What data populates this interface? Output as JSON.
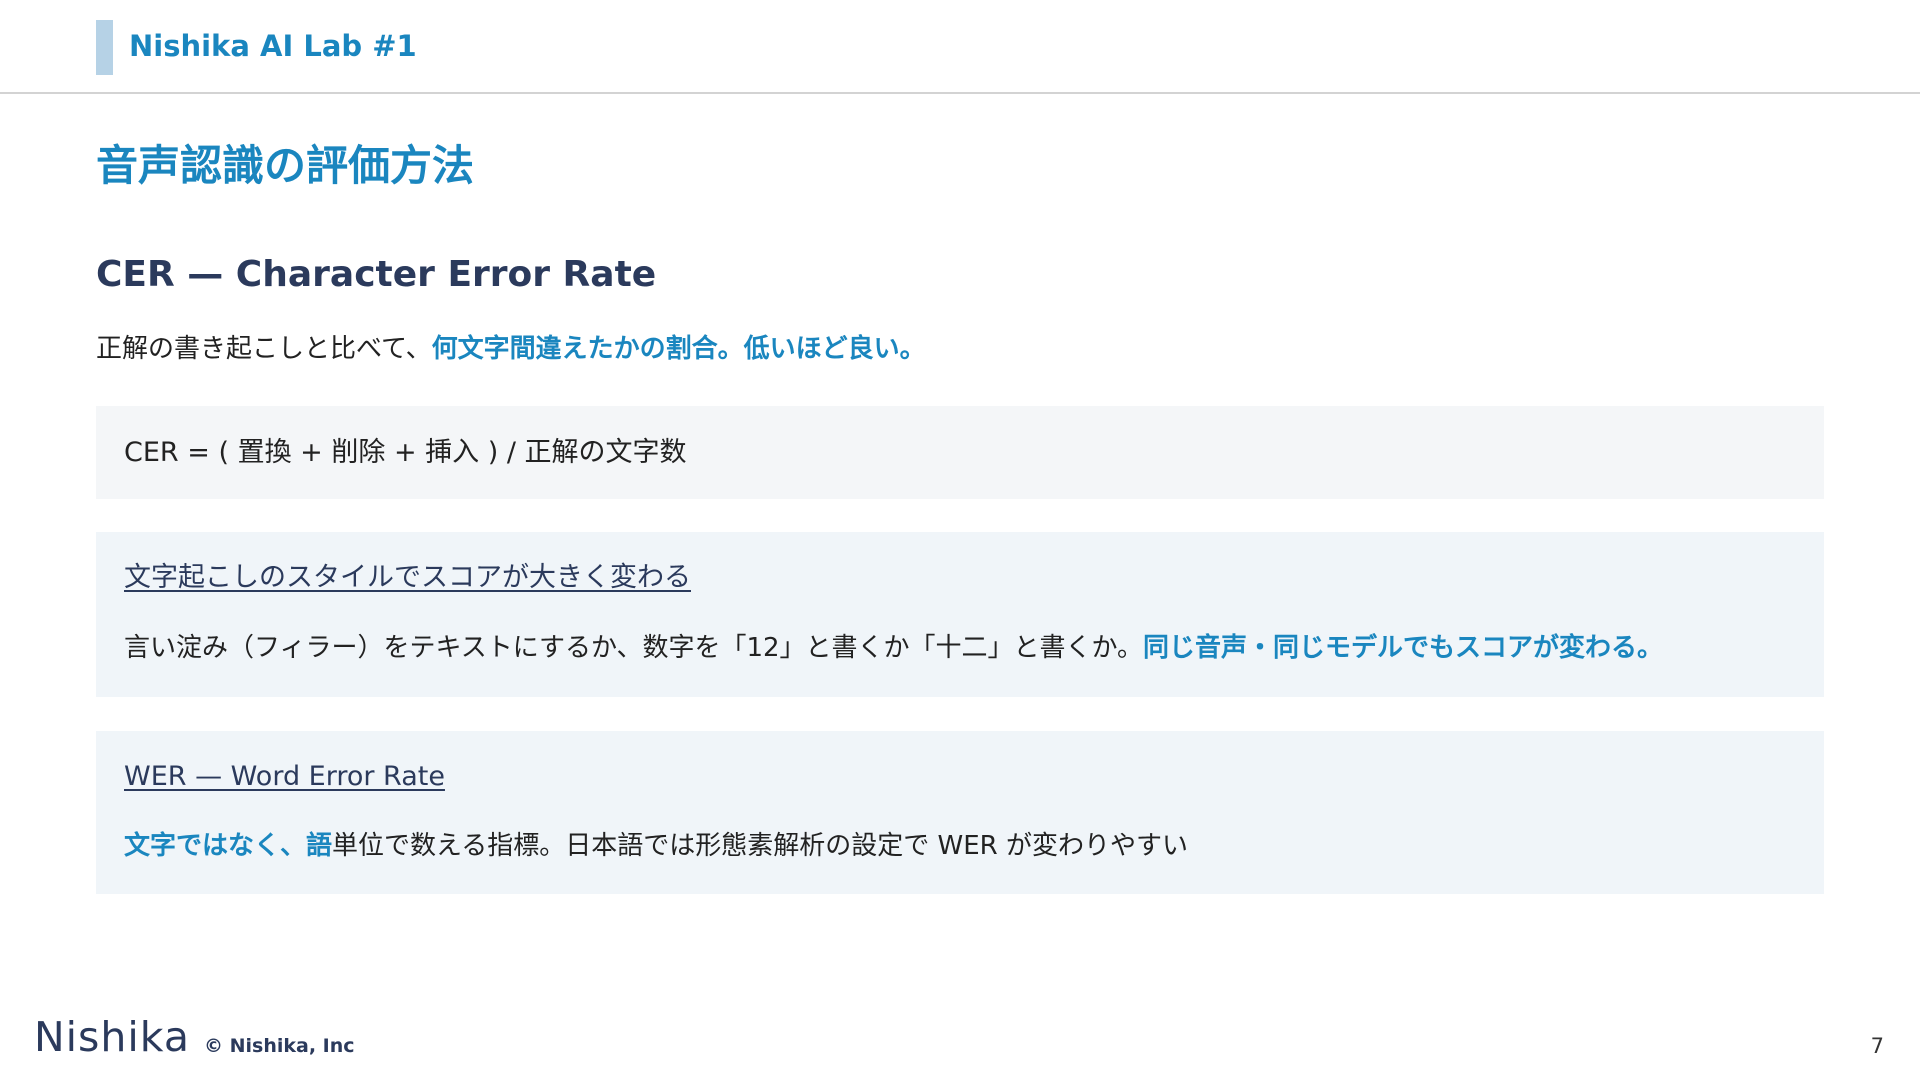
{
  "header": {
    "title": "Nishika AI Lab #1"
  },
  "page_title": "音声認識の評価方法",
  "section_title": "CER — Character Error Rate",
  "intro": {
    "plain": "正解の書き起こしと比べて、",
    "highlight": "何文字間違えたかの割合。低いほど良い。"
  },
  "formula": "CER = ( 置換 + 削除 + 挿入 ) / 正解の文字数",
  "notes": [
    {
      "title": "文字起こしのスタイルでスコアが大きく変わる",
      "body_plain": "言い淀み（フィラー）をテキストにするか、数字を「12」と書くか「十二」と書くか。",
      "body_highlight": "同じ音声・同じモデルでもスコアが変わる。"
    },
    {
      "title": "WER — Word Error Rate",
      "body_highlight": "文字ではなく、語",
      "body_plain": "単位で数える指標。日本語では形態素解析の設定で WER が変わりやすい"
    }
  ],
  "footer": {
    "logo": "Nishika",
    "copyright": "© Nishika, Inc",
    "page_number": "7"
  },
  "colors": {
    "accent": "#1a86bf",
    "navy": "#2b3a5c",
    "box_gray": "#f4f6f8",
    "box_blue": "#f0f5f9",
    "header_bar": "#b6d2e6"
  }
}
